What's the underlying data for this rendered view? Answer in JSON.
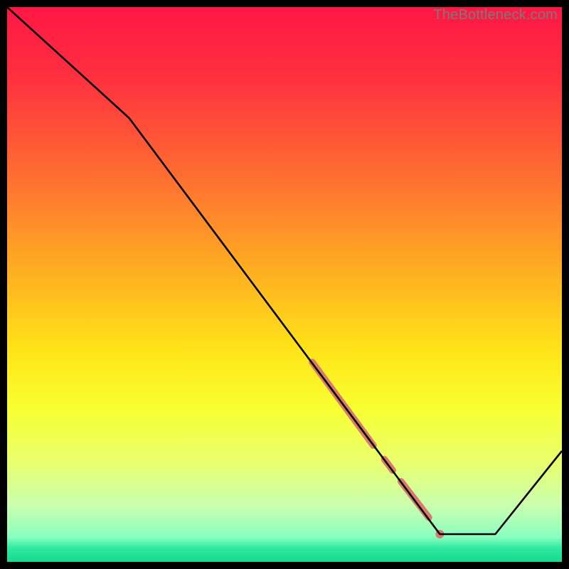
{
  "watermark": "TheBottleneck.com",
  "gradient_stops": [
    {
      "offset": 0.0,
      "color": "#ff1744"
    },
    {
      "offset": 0.12,
      "color": "#ff2e3f"
    },
    {
      "offset": 0.25,
      "color": "#ff5a36"
    },
    {
      "offset": 0.38,
      "color": "#ff8a2a"
    },
    {
      "offset": 0.5,
      "color": "#ffb81f"
    },
    {
      "offset": 0.62,
      "color": "#ffe419"
    },
    {
      "offset": 0.72,
      "color": "#f8ff2f"
    },
    {
      "offset": 0.82,
      "color": "#e9ff6d"
    },
    {
      "offset": 0.9,
      "color": "#c8ffb0"
    },
    {
      "offset": 0.955,
      "color": "#8affc0"
    },
    {
      "offset": 0.975,
      "color": "#30e9a0"
    },
    {
      "offset": 1.0,
      "color": "#17d98f"
    }
  ],
  "chart_data": {
    "type": "line",
    "title": "",
    "xlabel": "",
    "ylabel": "",
    "xlim": [
      0,
      100
    ],
    "ylim": [
      0,
      100
    ],
    "series": [
      {
        "name": "curve",
        "x": [
          0,
          22,
          78,
          88,
          100
        ],
        "values": [
          100,
          80,
          5,
          5,
          20
        ]
      }
    ],
    "highlight_segments": [
      {
        "x0": 55,
        "y0": 36,
        "x1": 66,
        "y1": 21,
        "thickness": 6
      },
      {
        "x0": 68,
        "y0": 18.5,
        "x1": 69.5,
        "y1": 16.5,
        "thickness": 6
      },
      {
        "x0": 71,
        "y0": 14.5,
        "x1": 76,
        "y1": 8,
        "thickness": 6
      }
    ],
    "highlight_points": [
      {
        "x": 78,
        "y": 5,
        "r": 5
      }
    ],
    "highlight_color": "#d97a6d"
  }
}
